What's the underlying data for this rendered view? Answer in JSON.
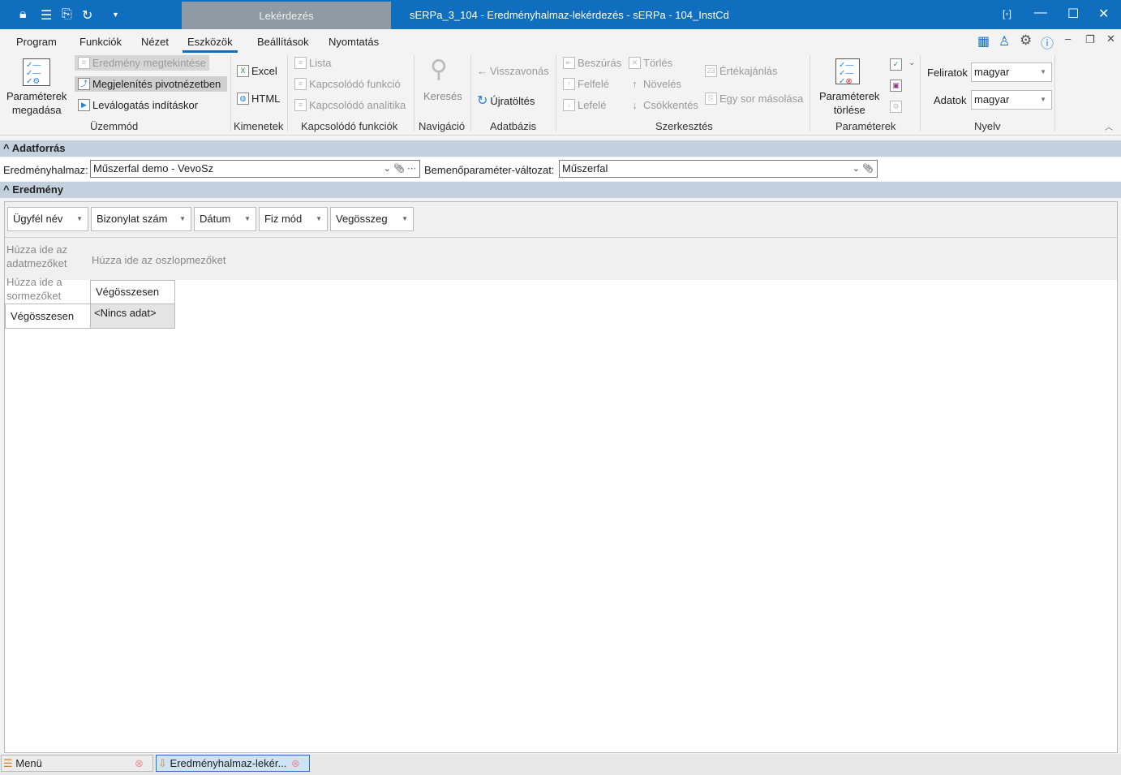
{
  "titlebar": {
    "context_tab": "Lekérdezés",
    "title": "sERPa_3_104 - Eredményhalmaz-lekérdezés - sERPa - 104_InstCd"
  },
  "menu": {
    "tabs": [
      "Program",
      "Funkciók",
      "Nézet",
      "Eszközök",
      "Beállítások",
      "Nyomtatás"
    ],
    "active": "Eszközök"
  },
  "ribbon": {
    "uzemmod": {
      "params": "Paraméterek",
      "params2": "megadása",
      "view": "Eredmény megtekintése",
      "pivot": "Megjelenítés pivotnézetben",
      "filter": "Leválogatás indításkor",
      "label": "Üzemmód"
    },
    "kimenetek": {
      "excel": "Excel",
      "html": "HTML",
      "label": "Kimenetek"
    },
    "kapcsolodo": {
      "lista": "Lista",
      "funkcio": "Kapcsolódó funkció",
      "analitika": "Kapcsolódó analitika",
      "label": "Kapcsolódó funkciók"
    },
    "navigacio": {
      "search": "Keresés",
      "label": "Navigáció"
    },
    "adatbazis": {
      "undo": "Visszavonás",
      "reload": "Újratöltés",
      "label": "Adatbázis"
    },
    "szerkesztes": {
      "insert": "Beszúrás",
      "up": "Felfelé",
      "down": "Lefelé",
      "delete": "Törlés",
      "inc": "Növelés",
      "dec": "Csökkentés",
      "suggest": "Értékajánlás",
      "copy": "Egy sor másolása",
      "label": "Szerkesztés"
    },
    "parameterek": {
      "clear": "Paraméterek",
      "clear2": "törlése",
      "label": "Paraméterek"
    },
    "nyelv": {
      "captions_label": "Feliratok",
      "captions_value": "magyar",
      "data_label": "Adatok",
      "data_value": "magyar",
      "label": "Nyelv"
    }
  },
  "adatforras": {
    "header": "Adatforrás",
    "resultset_label": "Eredményhalmaz:",
    "resultset_value": "Műszerfal demo - VevoSz",
    "variant_label": "Bemenőparaméter-változat:",
    "variant_value": "Műszerfal"
  },
  "eredmeny": {
    "header": "Eredmény",
    "fields": [
      "Ügyfél név",
      "Bizonylat szám",
      "Dátum",
      "Fiz mód",
      "Vegösszeg"
    ],
    "data_hint": "Húzza ide az adatmezőket",
    "column_hint": "Húzza ide az oszlopmezőket",
    "row_hint": "Húzza ide a sormezőket",
    "col_total": "Végösszesen",
    "row_total": "Végösszesen",
    "no_data": "<Nincs adat>"
  },
  "taskbar": {
    "items": [
      "Menü",
      "Eredményhalmaz-lekér..."
    ]
  }
}
